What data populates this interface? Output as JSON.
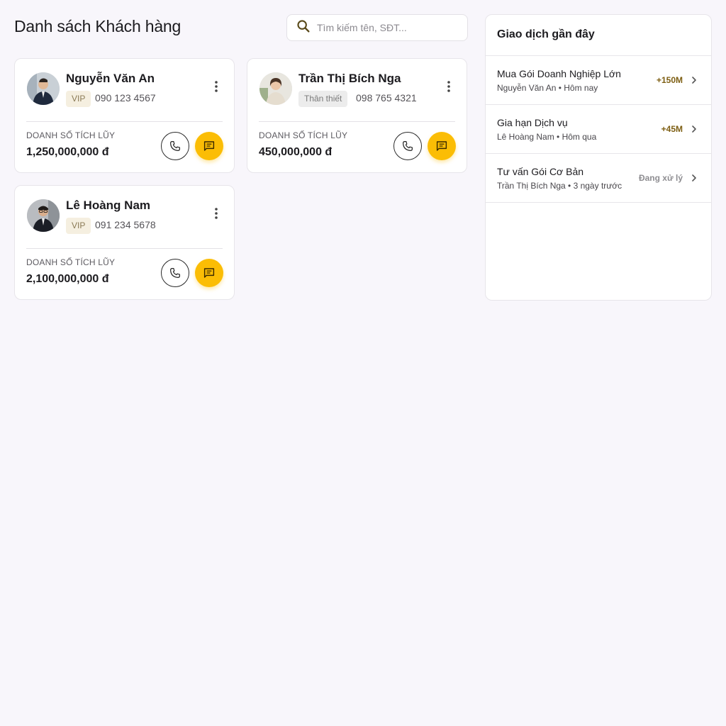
{
  "page": {
    "title": "Danh sách Khách hàng"
  },
  "search": {
    "placeholder": "Tìm kiếm tên, SĐT...",
    "icon": "search-icon"
  },
  "customers": [
    {
      "name": "Nguyễn Văn An",
      "tier": "VIP",
      "phone": "090 123 4567",
      "sales_label": "DOANH SỐ TÍCH LŨY",
      "sales_value": "1,250,000,000 đ"
    },
    {
      "name": "Trần Thị Bích Nga",
      "tier": "Thân thiết",
      "phone": "098 765 4321",
      "sales_label": "DOANH SỐ TÍCH LŨY",
      "sales_value": "450,000,000 đ"
    },
    {
      "name": "Lê Hoàng Nam",
      "tier": "VIP",
      "phone": "091 234 5678",
      "sales_label": "DOANH SỐ TÍCH LŨY",
      "sales_value": "2,100,000,000 đ"
    }
  ],
  "transactions": {
    "title": "Giao dịch gần đây",
    "items": [
      {
        "name": "Mua Gói Doanh Nghiệp Lớn",
        "sub": "Nguyễn Văn An • Hôm nay",
        "amount": "+150M",
        "status": "done"
      },
      {
        "name": "Gia hạn Dịch vụ",
        "sub": "Lê Hoàng Nam • Hôm qua",
        "amount": "+45M",
        "status": "done"
      },
      {
        "name": "Tư vấn Gói Cơ Bản",
        "sub": "Trần Thị Bích Nga • 3 ngày trước",
        "amount": "Đang xử lý",
        "status": "pending"
      }
    ]
  },
  "colors": {
    "accent": "#fbbd05",
    "amount": "#7d5e12",
    "vip_badge_bg": "#f5efe0",
    "loyal_badge_bg": "#ececec",
    "background": "#f8f6fb"
  }
}
